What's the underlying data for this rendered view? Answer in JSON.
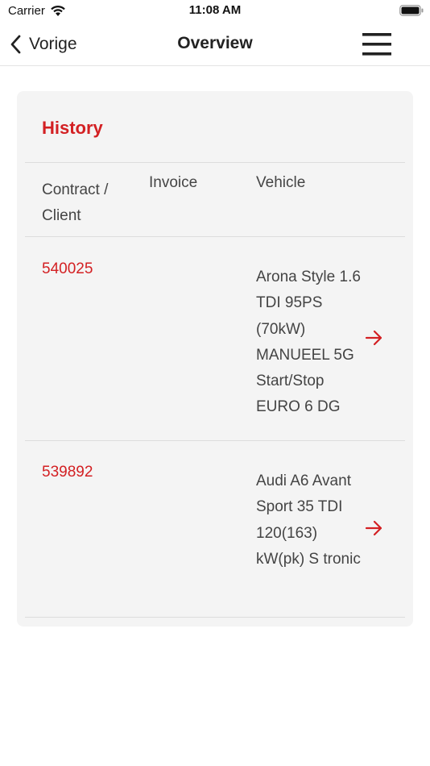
{
  "status_bar": {
    "carrier": "Carrier",
    "time": "11:08 AM"
  },
  "nav": {
    "back_label": "Vorige",
    "title": "Overview",
    "menu_icon": "hamburger-menu-icon"
  },
  "history": {
    "title": "History",
    "columns": {
      "contract": "Contract / Client",
      "invoice": "Invoice",
      "vehicle": "Vehicle"
    },
    "rows": [
      {
        "contract": "540025",
        "invoice": "",
        "vehicle": "Arona Style 1.6 TDI 95PS (70kW) MANUEEL 5G Start/Stop EURO 6 DG"
      },
      {
        "contract": "539892",
        "invoice": "",
        "vehicle": "Audi A6 Avant Sport 35 TDI 120(163) kW(pk) S tronic"
      }
    ]
  },
  "colors": {
    "accent": "#d32023",
    "card_background": "#f4f4f4",
    "divider": "#dcdcdc"
  }
}
